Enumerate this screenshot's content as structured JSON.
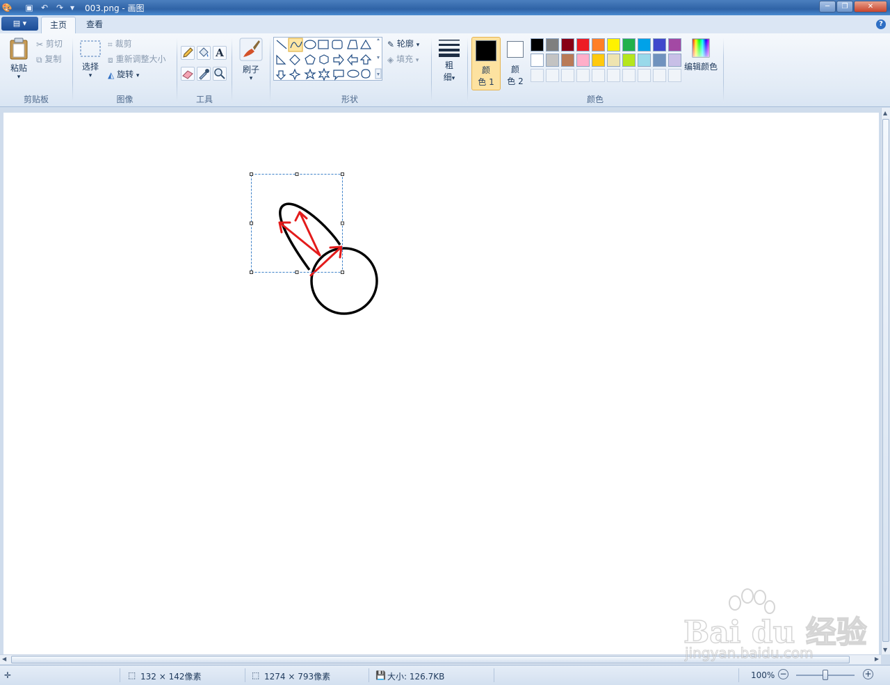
{
  "window": {
    "title": "003.png - 画图",
    "minimize": "─",
    "maximize": "❐",
    "close": "✕"
  },
  "quick_access": {
    "app_icon": "paint-app-icon",
    "save": "save-icon",
    "undo": "undo-icon",
    "redo": "redo-icon",
    "customize": "▾"
  },
  "tabs": {
    "app_menu": "▤ ▾",
    "home": "主页",
    "view": "查看",
    "help": "?"
  },
  "clipboard": {
    "paste": "粘贴",
    "cut": "剪切",
    "copy": "复制",
    "label": "剪贴板"
  },
  "image": {
    "select": "选择",
    "crop": "裁剪",
    "resize": "重新调整大小",
    "rotate": "旋转",
    "label": "图像"
  },
  "tools": {
    "label": "工具",
    "items": [
      "pencil-icon",
      "fill-bucket-icon",
      "text-icon",
      "eraser-icon",
      "color-picker-icon",
      "magnifier-icon"
    ]
  },
  "brushes": {
    "label": "刷子"
  },
  "shapes": {
    "outline": "轮廓",
    "fill": "填充",
    "label": "形状",
    "selected": "curve"
  },
  "size": {
    "line1": "粗",
    "line2": "细"
  },
  "colors": {
    "color1_line1": "颜",
    "color1_line2": "色 1",
    "color2_line1": "颜",
    "color2_line2": "色 2",
    "edit": "编辑颜色",
    "label": "颜色",
    "color1": "#000000",
    "color2": "#ffffff",
    "palette_row1": [
      "#000000",
      "#7f7f7f",
      "#880015",
      "#ed1c24",
      "#ff7f27",
      "#fff200",
      "#22b14c",
      "#00a2e8",
      "#3f48cc",
      "#a349a4"
    ],
    "palette_row2": [
      "#ffffff",
      "#c3c3c3",
      "#b97a57",
      "#ffaec9",
      "#ffc90e",
      "#efe4b0",
      "#b5e61d",
      "#99d9ea",
      "#7092be",
      "#c8bfe7"
    ],
    "palette_row3": [
      "#f0f4f9",
      "#f0f4f9",
      "#f0f4f9",
      "#f0f4f9",
      "#f0f4f9",
      "#f0f4f9",
      "#f0f4f9",
      "#f0f4f9",
      "#f0f4f9",
      "#f0f4f9"
    ]
  },
  "status": {
    "selection_size": "132 × 142像素",
    "image_size": "1274 × 793像素",
    "file_size": "大小: 126.7KB",
    "zoom": "100%",
    "zoom_level": 0.5
  },
  "watermark": {
    "brand": "Bai du 经验",
    "url": "jingyan.baidu.com"
  }
}
